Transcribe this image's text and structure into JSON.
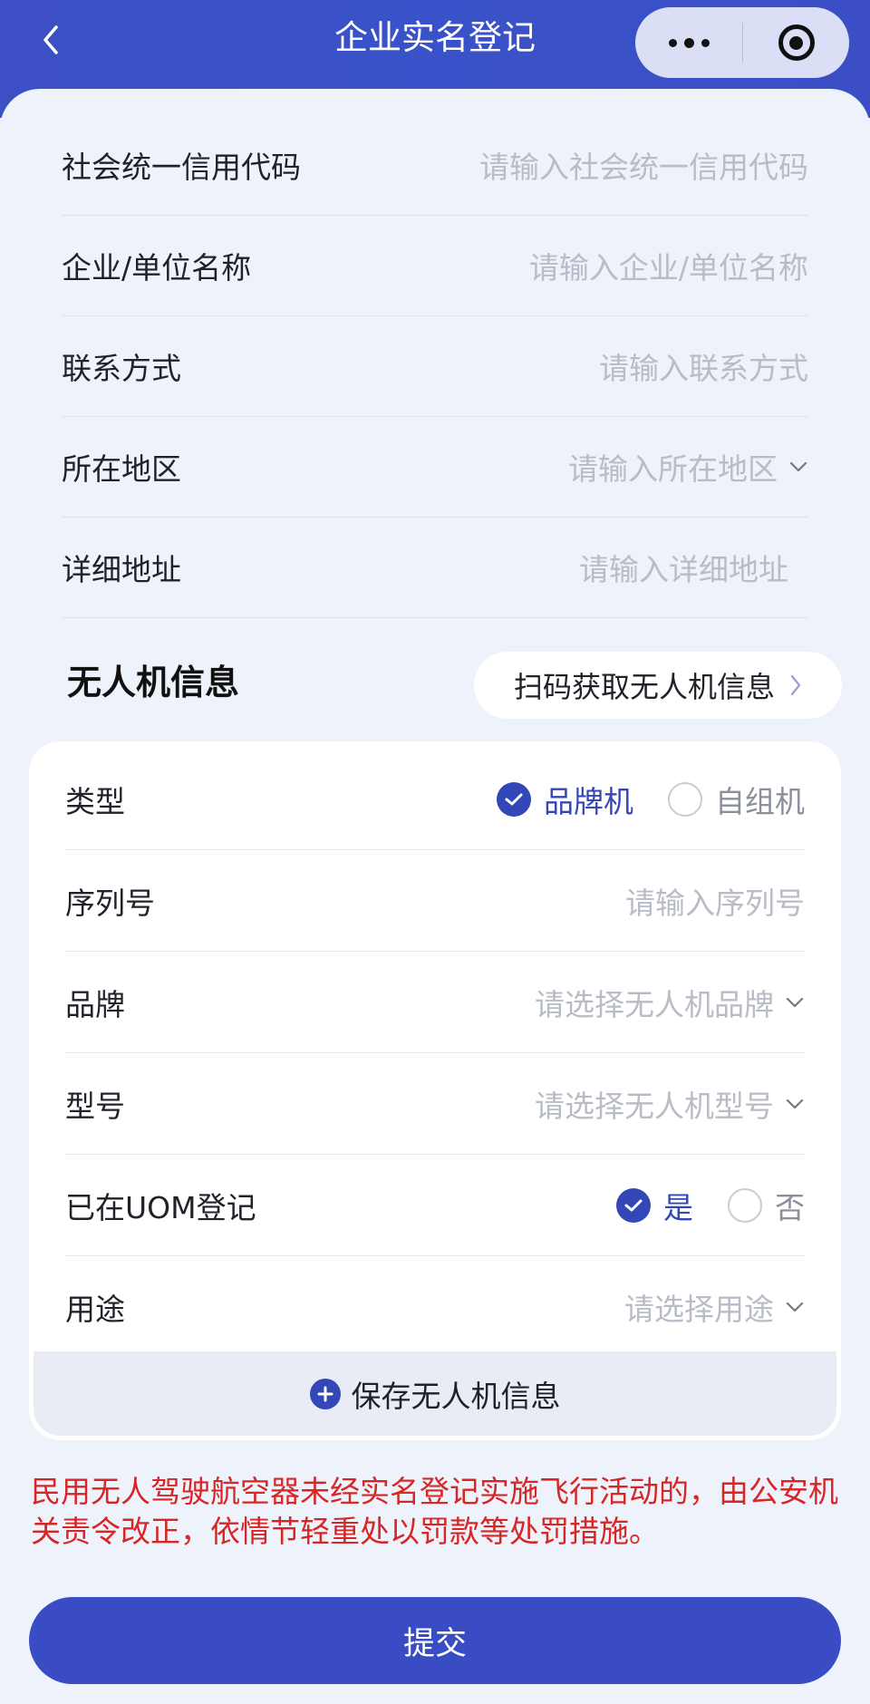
{
  "nav": {
    "title": "企业实名登记",
    "back_icon": "chevron-left-icon",
    "more_icon": "more-dots-icon",
    "target_icon": "target-icon"
  },
  "company_form": {
    "fields": [
      {
        "label": "社会统一信用代码",
        "placeholder": "请输入社会统一信用代码",
        "dropdown": false
      },
      {
        "label": "企业/单位名称",
        "placeholder": "请输入企业/单位名称",
        "dropdown": false
      },
      {
        "label": "联系方式",
        "placeholder": "请输入联系方式",
        "dropdown": false
      },
      {
        "label": "所在地区",
        "placeholder": "请输入所在地区",
        "dropdown": true
      },
      {
        "label": "详细地址",
        "placeholder": "请输入详细地址",
        "dropdown": false
      }
    ]
  },
  "drone_section": {
    "title": "无人机信息",
    "scan_button": "扫码获取无人机信息",
    "type": {
      "label": "类型",
      "options": [
        "品牌机",
        "自组机"
      ],
      "selected": "品牌机"
    },
    "serial": {
      "label": "序列号",
      "placeholder": "请输入序列号"
    },
    "brand": {
      "label": "品牌",
      "placeholder": "请选择无人机品牌"
    },
    "model": {
      "label": "型号",
      "placeholder": "请选择无人机型号"
    },
    "uom": {
      "label": "已在UOM登记",
      "options": [
        "是",
        "否"
      ],
      "selected": "是"
    },
    "usage": {
      "label": "用途",
      "placeholder": "请选择用途"
    },
    "save_button": "保存无人机信息"
  },
  "warning": "民用无人驾驶航空器未经实名登记实施飞行活动的，由公安机关责令改正，依情节轻重处以罚款等处罚措施。",
  "submit_button": "提交",
  "colors": {
    "header": "#3a4fc7",
    "accent": "#3447b6",
    "warning": "#d62626",
    "page_bg": "#eef2fb"
  }
}
